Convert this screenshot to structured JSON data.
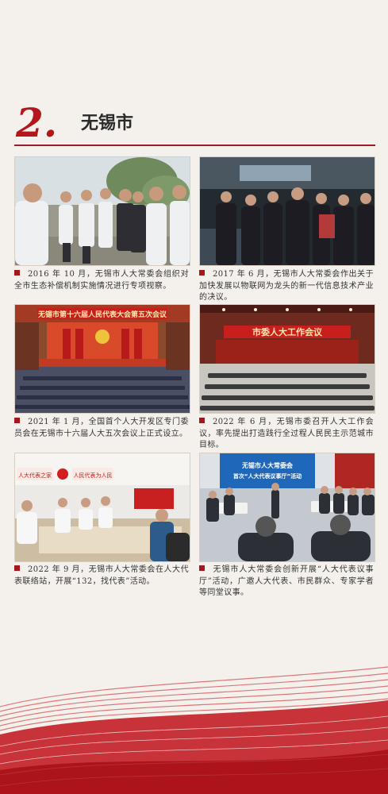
{
  "section": {
    "number": "2.",
    "title": "无锡市"
  },
  "photos": [
    {
      "caption": "2016 年 10 月，无锡市人大常委会组织对全市生态补偿机制实施情况进行专项视察。"
    },
    {
      "caption": "2017 年 6 月，无锡市人大常委会作出关于加快发展以物联网为龙头的新一代信息技术产业的决议。"
    },
    {
      "caption": "2021 年 1 月，全国首个人大开发区专门委员会在无锡市十六届人大五次会议上正式设立。",
      "sign": "无锡市第十六届人民代表大会第五次会议"
    },
    {
      "caption": "2022 年 6 月，无锡市委召开人大工作会议，率先提出打造践行全过程人民民主示范城市目标。",
      "sign": "市委人大工作会议"
    },
    {
      "caption": "2022 年 9 月，无锡市人大常委会在人大代表联络站，开展“132，找代表”活动。",
      "sign1": "人大代表之家",
      "sign2": "人民代表为人民"
    },
    {
      "caption": "无锡市人大常委会创新开展“人大代表议事厅”活动，广邀人大代表、市民群众、专家学者等同堂议事。",
      "screen_line1": "无锡市人大常委会",
      "screen_line2": "首次“人大代表议事厅”活动"
    }
  ],
  "colors": {
    "accent": "#b3161b",
    "background": "#f4f1ec"
  }
}
